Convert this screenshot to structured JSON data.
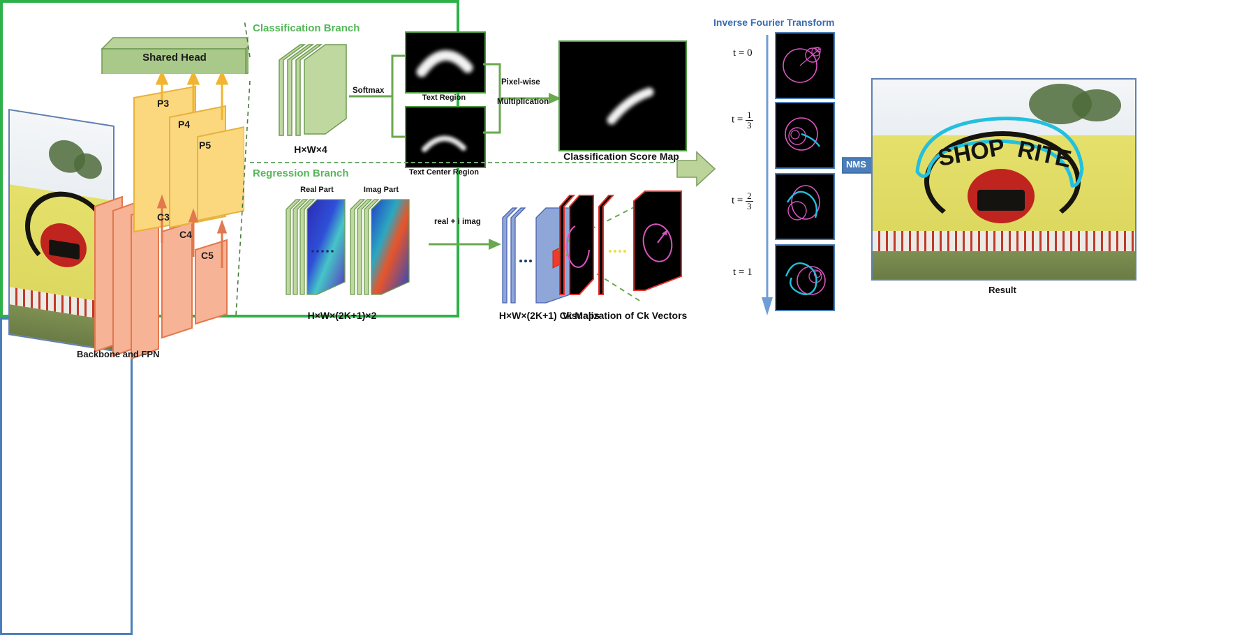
{
  "figure": {
    "type": "architecture-diagram",
    "description": "Text detection network pipeline: Backbone and FPN feeding a Shared Head with classification and regression branches, Fourier contour reconstruction and NMS to final result."
  },
  "backbone": {
    "caption": "Backbone and FPN",
    "shared_head_label": "Shared Head",
    "pyramid_levels": [
      "P3",
      "P4",
      "P5"
    ],
    "backbone_levels": [
      "C3",
      "C4",
      "C5"
    ],
    "input_image_alt": "SHOP RITE billboard photo"
  },
  "classification_branch": {
    "title": "Classification Branch",
    "feature_label": "H×W×4",
    "op_softmax": "Softmax",
    "op_mult_line1": "Pixel-wise",
    "op_mult_line2": "Multiplication",
    "map_text_region": "Text Region",
    "map_text_center_region": "Text Center Region",
    "map_score": "Classification Score Map"
  },
  "regression_branch": {
    "title": "Regression Branch",
    "real_part_label": "Real Part",
    "imag_part_label": "Imag Part",
    "feature_label": "H×W×(2K+1)×2",
    "op_combine": "real + i imag",
    "ck_maps_label": "H×W×(2K+1) Ck Maps",
    "visualization_label": "Visualization of Ck Vectors"
  },
  "inverse_fourier": {
    "title": "Inverse Fourier Transform",
    "steps": [
      {
        "label_plain": "t = 0",
        "lhs": "t =",
        "num": "",
        "den": "",
        "whole": "0"
      },
      {
        "label_plain": "t = 1/3",
        "lhs": "t =",
        "num": "1",
        "den": "3",
        "whole": ""
      },
      {
        "label_plain": "t = 2/3",
        "lhs": "t =",
        "num": "2",
        "den": "3",
        "whole": ""
      },
      {
        "label_plain": "t = 1",
        "lhs": "t =",
        "num": "",
        "den": "",
        "whole": "1"
      }
    ]
  },
  "nms": {
    "label": "NMS"
  },
  "result": {
    "caption": "Result",
    "image_alt": "SHOP RITE billboard with detected curved text contour highlighted in cyan"
  },
  "colors": {
    "panel_green": "#2fb14a",
    "branch_title_green": "#56b65a",
    "arrow_green": "#6aa84f",
    "fpn_yellow": "#fbd77e",
    "backbone_orange": "#f7b395",
    "shared_head_green": "#a9c98a",
    "ift_blue": "#4a7ebb",
    "nms_blue": "#4a7ebb",
    "ck_blue": "#8fa6d8",
    "vis_red": "#e8332a",
    "curve_magenta": "#e060c0",
    "curve_cyan": "#22c0dd"
  }
}
